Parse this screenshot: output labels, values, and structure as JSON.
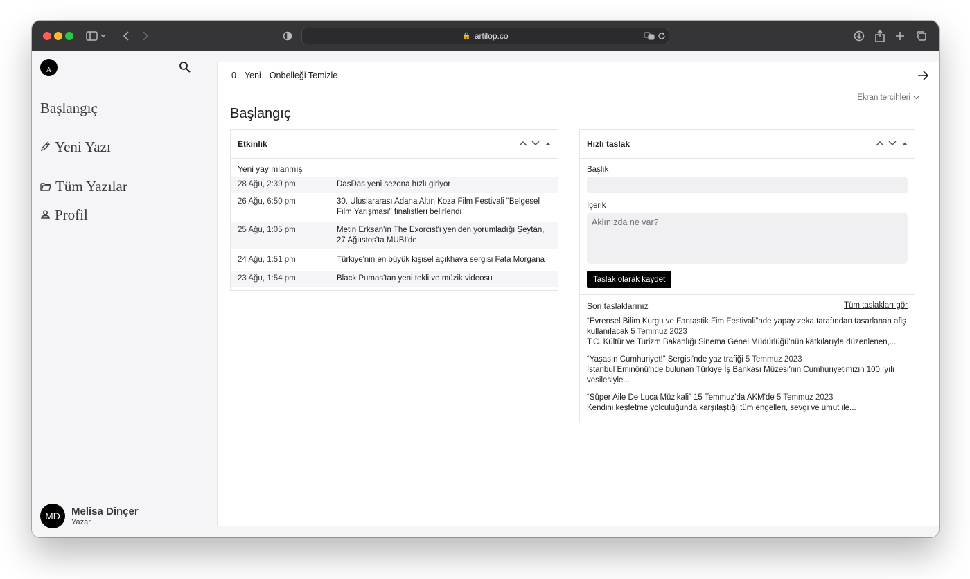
{
  "browser": {
    "url": "artilop.co"
  },
  "sidebar": {
    "logo_letter": "A",
    "items": [
      {
        "label": "Başlangıç",
        "icon": ""
      },
      {
        "label": "Yeni Yazı",
        "icon": "pencil-icon"
      },
      {
        "label": "Tüm Yazılar",
        "icon": "folder-icon"
      },
      {
        "label": "Profil",
        "icon": "user-icon"
      }
    ],
    "user": {
      "initials": "MD",
      "name": "Melisa Dinçer",
      "role": "Yazar"
    }
  },
  "topbar": {
    "count": "0",
    "new_label": "Yeni",
    "clear_cache_label": "Önbelleği Temizle"
  },
  "screen_prefs": "Ekran tercihleri",
  "page_title": "Başlangıç",
  "activity": {
    "title": "Etkinlik",
    "subtitle": "Yeni yayımlanmış",
    "rows": [
      {
        "date": "28 Ağu, 2:39 pm",
        "title": "DasDas yeni sezona hızlı giriyor"
      },
      {
        "date": "26 Ağu, 6:50 pm",
        "title": "30. Uluslararası Adana Altın Koza Film Festivali \"Belgesel Film Yarışması\" finalistleri belirlendi"
      },
      {
        "date": "25 Ağu, 1:05 pm",
        "title": "Metin Erksan'ın The Exorcist'i yeniden yorumladığı Şeytan, 27 Ağustos'ta MUBI'de"
      },
      {
        "date": "24 Ağu, 1:51 pm",
        "title": "Türkiye'nin en büyük kişisel açıkhava sergisi Fata Morgana"
      },
      {
        "date": "23 Ağu, 1:54 pm",
        "title": "Black Pumas'tan yeni tekli ve müzik videosu"
      }
    ]
  },
  "quick_draft": {
    "title": "Hızlı taslak",
    "title_label": "Başlık",
    "content_label": "İçerik",
    "content_placeholder": "Aklınızda ne var?",
    "save_label": "Taslak olarak kaydet",
    "recent_label": "Son taslaklarınız",
    "all_drafts_label": "Tüm taslakları gör",
    "drafts": [
      {
        "title": "“Evrensel Bilim Kurgu ve Fantastik Fim Festivali”nde yapay zeka tarafından tasarlanan afiş kullanılacak",
        "date": "5 Temmuz 2023",
        "excerpt": "T.C. Kültür ve Turizm Bakanlığı Sinema Genel Müdürlüğü'nün katkılarıyla düzenlenen,..."
      },
      {
        "title": "“Yaşasın Cumhuriyet!” Sergisi'nde yaz trafiği",
        "date": "5 Temmuz 2023",
        "excerpt": "İstanbul Eminönü'nde bulunan Türkiye İş Bankası Müzesi'nin Cumhuriyetimizin 100. yılı vesilesiyle..."
      },
      {
        "title": "“Süper Aile De Luca Müzikali” 15 Temmuz'da AKM'de",
        "date": "5 Temmuz 2023",
        "excerpt": "Kendini keşfetme yolculuğunda karşılaştığı tüm engelleri, sevgi ve umut ile..."
      }
    ]
  }
}
